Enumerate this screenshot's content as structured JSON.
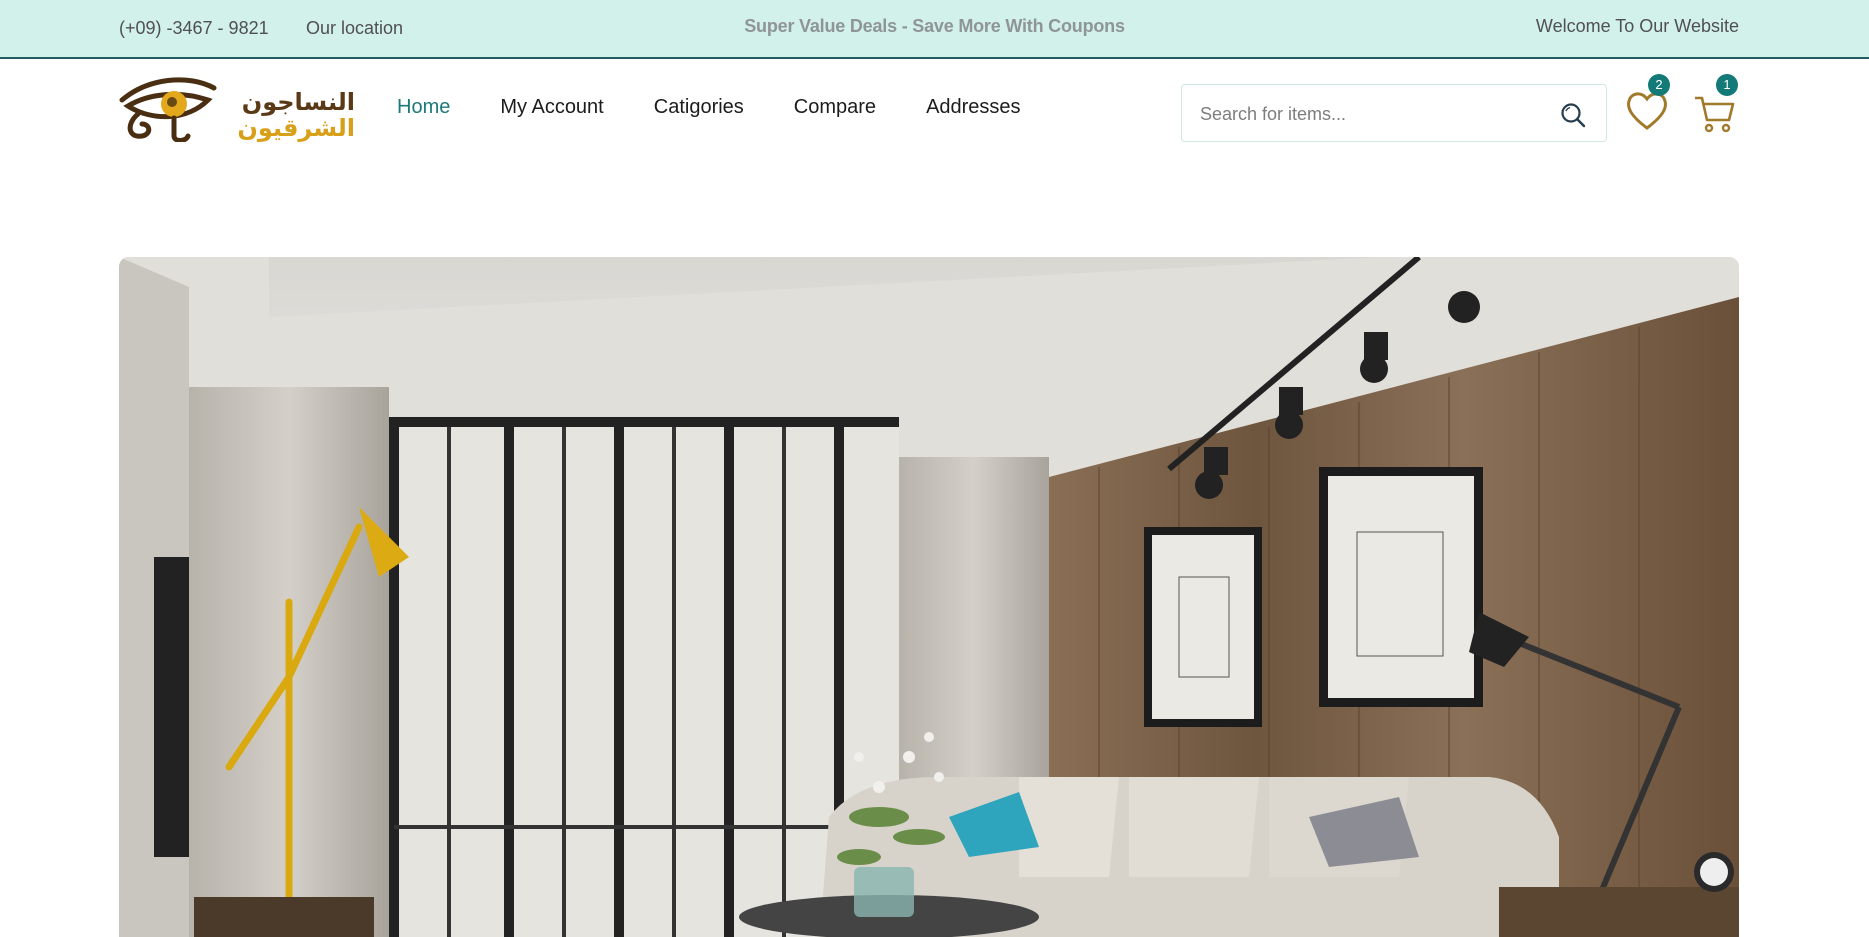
{
  "topbar": {
    "phone": "(+09) -3467 - 9821",
    "location": "Our location",
    "deals": "Super Value Deals - Save More With Coupons",
    "welcome": "Welcome To Our Website"
  },
  "logo": {
    "line1": "النساجون",
    "line2": "الشرقيون"
  },
  "nav": {
    "items": [
      {
        "label": "Home",
        "active": true
      },
      {
        "label": "My Account"
      },
      {
        "label": "Catigories"
      },
      {
        "label": "Compare"
      },
      {
        "label": "Addresses"
      }
    ]
  },
  "search": {
    "placeholder": "Search for items..."
  },
  "wishlist": {
    "count": "2"
  },
  "cart": {
    "count": "1"
  },
  "colors": {
    "accent": "#1b7a78",
    "topbar_bg": "#d2f1eb",
    "badge": "#137a78",
    "brand_gold": "#d8a019",
    "brand_brown": "#5a3a16"
  },
  "hero": {
    "image": "living-room-interior"
  }
}
